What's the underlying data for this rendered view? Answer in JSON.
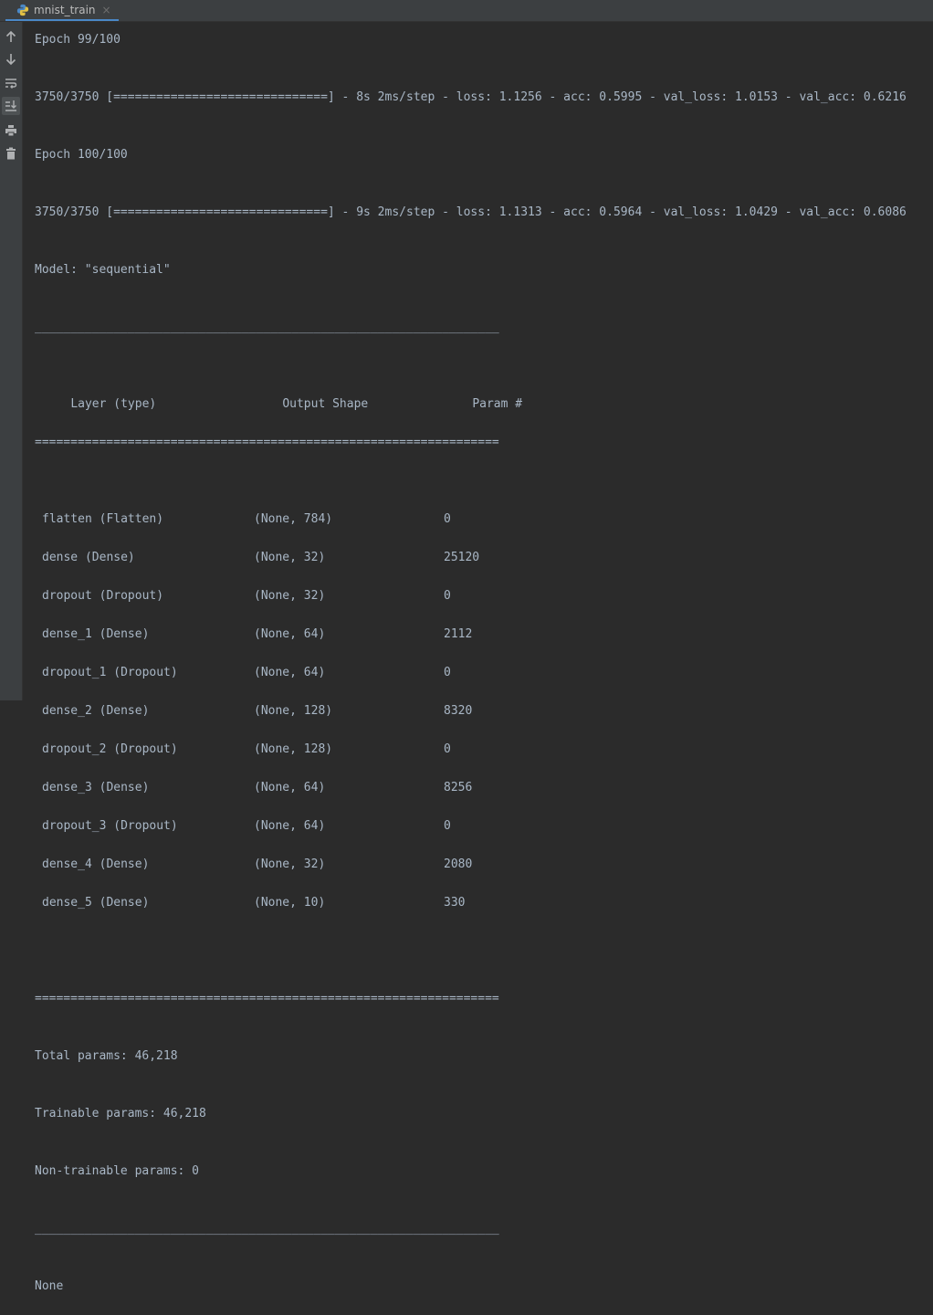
{
  "tab": {
    "title": "mnist_train",
    "close": "×"
  },
  "toolbar": {
    "up_icon": "up-arrow-icon",
    "down_icon": "down-arrow-icon",
    "wrap_icon": "soft-wrap-icon",
    "scroll_icon": "scroll-to-end-icon",
    "print_icon": "print-icon",
    "trash_icon": "trash-icon"
  },
  "console": {
    "partial_epoch": "Epoch 99/100",
    "epoch99_progress": "3750/3750 [==============================] - 8s 2ms/step - loss: 1.1256 - acc: 0.5995 - val_loss: 1.0153 - val_acc: 0.6216",
    "epoch100_label": "Epoch 100/100",
    "epoch100_progress": "3750/3750 [==============================] - 9s 2ms/step - loss: 1.1313 - acc: 0.5964 - val_loss: 1.0429 - val_acc: 0.6086",
    "model_name": "Model: \"sequential\"",
    "rule_single": "_________________________________________________________________",
    "rule_double": "=================================================================",
    "header": {
      "layer": "Layer (type)",
      "shape": "Output Shape",
      "param": "Param #"
    },
    "rows": [
      {
        "layer": "flatten (Flatten)",
        "shape": "(None, 784)",
        "param": "0"
      },
      {
        "layer": "dense (Dense)",
        "shape": "(None, 32)",
        "param": "25120"
      },
      {
        "layer": "dropout (Dropout)",
        "shape": "(None, 32)",
        "param": "0"
      },
      {
        "layer": "dense_1 (Dense)",
        "shape": "(None, 64)",
        "param": "2112"
      },
      {
        "layer": "dropout_1 (Dropout)",
        "shape": "(None, 64)",
        "param": "0"
      },
      {
        "layer": "dense_2 (Dense)",
        "shape": "(None, 128)",
        "param": "8320"
      },
      {
        "layer": "dropout_2 (Dropout)",
        "shape": "(None, 128)",
        "param": "0"
      },
      {
        "layer": "dense_3 (Dense)",
        "shape": "(None, 64)",
        "param": "8256"
      },
      {
        "layer": "dropout_3 (Dropout)",
        "shape": "(None, 64)",
        "param": "0"
      },
      {
        "layer": "dense_4 (Dense)",
        "shape": "(None, 32)",
        "param": "2080"
      },
      {
        "layer": "dense_5 (Dense)",
        "shape": "(None, 10)",
        "param": "330"
      }
    ],
    "total_params": "Total params: 46,218",
    "trainable_params": "Trainable params: 46,218",
    "non_trainable_params": "Non-trainable params: 0",
    "return_value": "None"
  }
}
